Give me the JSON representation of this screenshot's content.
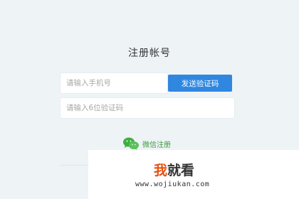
{
  "form": {
    "title": "注册帐号",
    "phone": {
      "value": "",
      "placeholder": "请输入手机号"
    },
    "send_code_label": "发送验证码",
    "code": {
      "value": "",
      "placeholder": "请输入6位验证码"
    },
    "wechat_label": "微信注册"
  },
  "watermark": {
    "logo_char_1": "我",
    "logo_rest": "就看",
    "url": "www.wojiukan.com"
  },
  "colors": {
    "background": "#eef3f6",
    "button": "#2f87e0",
    "wechat": "#3f9a3f",
    "logo_accent": "#e8500e"
  },
  "icons": {
    "wechat": "wechat-icon"
  }
}
